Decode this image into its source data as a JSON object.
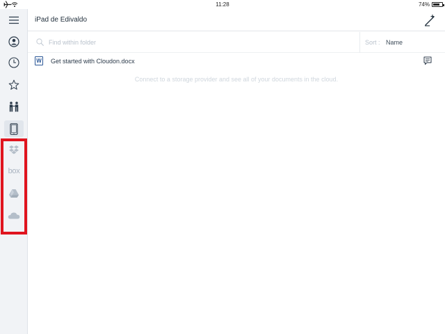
{
  "status_bar": {
    "time": "11:28",
    "battery_percent": "74%",
    "battery_level": 0.74
  },
  "sidebar": {
    "items": [
      {
        "icon": "hamburger-menu-icon"
      },
      {
        "icon": "user-account-icon"
      },
      {
        "icon": "clock-recent-icon"
      },
      {
        "icon": "star-favorites-icon"
      },
      {
        "icon": "shared-people-icon"
      },
      {
        "icon": "ipad-device-icon",
        "selected": true
      }
    ],
    "providers": [
      {
        "icon": "dropbox-icon"
      },
      {
        "icon": "box-icon",
        "label": "box"
      },
      {
        "icon": "google-drive-icon"
      },
      {
        "icon": "onedrive-cloud-icon"
      }
    ],
    "highlight_color": "#e0141e"
  },
  "header": {
    "title": "iPad de Edivaldo",
    "compose_icon": "compose-edit-icon"
  },
  "search": {
    "placeholder": "Find within folder",
    "value": "",
    "sort_label": "Sort :",
    "sort_value": "Name"
  },
  "files": [
    {
      "name": "Get started with Cloudon.docx",
      "icon": "word-doc-icon",
      "icon_letter": "W",
      "action_icon": "comment-icon"
    }
  ],
  "hint": "Connect to a storage provider and see all of your documents in the cloud."
}
